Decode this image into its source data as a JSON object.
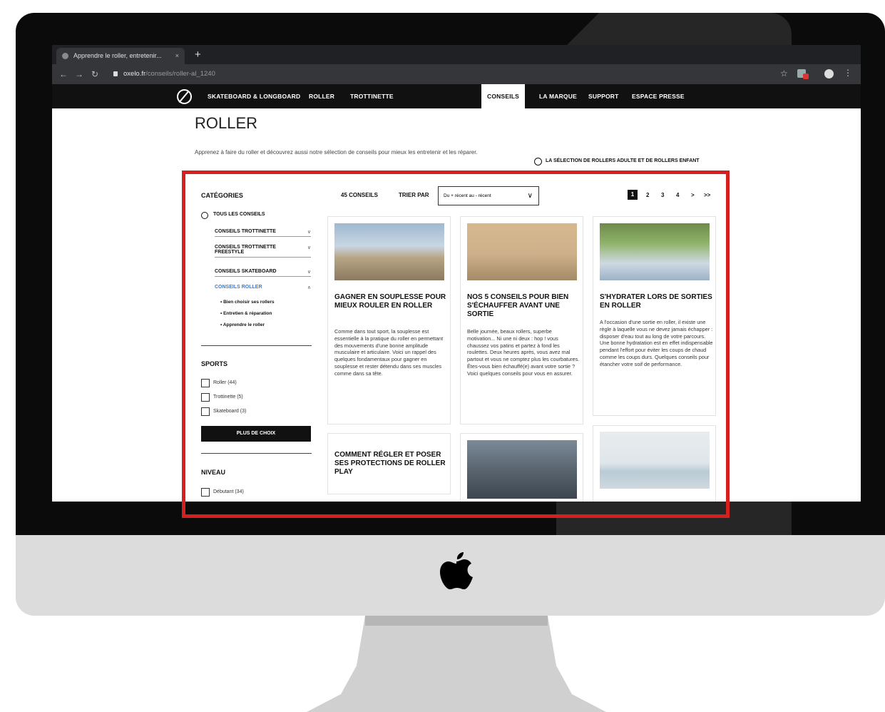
{
  "browser": {
    "tab_title": "Apprendre le roller, entretenir...",
    "tab_close": "×",
    "new_tab": "+",
    "url_host": "oxelo.fr",
    "url_path": "/conseils/roller-al_1240"
  },
  "site_nav": {
    "links": [
      "SKATEBOARD & LONGBOARD",
      "ROLLER",
      "TROTTINETTE",
      "CONSEILS",
      "LA MARQUE",
      "SUPPORT",
      "ESPACE PRESSE"
    ],
    "active": "CONSEILS"
  },
  "page": {
    "title": "ROLLER",
    "intro": "Apprenez à faire du roller et découvrez aussi notre sélection de conseils pour mieux les entretenir et les réparer.",
    "cta": "LA SÉLECTION DE ROLLERS ADULTE ET DE ROLLERS ENFANT"
  },
  "sidebar": {
    "categories_title": "CATÉGORIES",
    "all_link": "TOUS LES CONSEILS",
    "categories": [
      {
        "label": "CONSEILS TROTTINETTE",
        "chevron": "∨"
      },
      {
        "label": "CONSEILS TROTTINETTE FREESTYLE",
        "chevron": "∨"
      },
      {
        "label": "CONSEILS SKATEBOARD",
        "chevron": "∨"
      },
      {
        "label": "CONSEILS ROLLER",
        "chevron": "∧"
      }
    ],
    "roller_subitems": [
      "• Bien choisir ses rollers",
      "• Entretien & réparation",
      "• Apprendre le roller"
    ],
    "sports_title": "SPORTS",
    "sports": [
      "Roller (44)",
      "Trottinette (5)",
      "Skateboard (3)"
    ],
    "more_button": "PLUS DE CHOIX",
    "level_title": "NIVEAU",
    "levels": [
      "Débutant (34)"
    ]
  },
  "listing": {
    "count": "45 CONSEILS",
    "sort_label": "TRIER PAR",
    "sort_value": "Du + récent au - récent",
    "pagination": [
      "1",
      "2",
      "3",
      "4",
      ">",
      ">>"
    ],
    "current_page": "1"
  },
  "cards": [
    {
      "title": "GAGNER EN SOUPLESSE POUR MIEUX ROULER EN ROLLER",
      "body": "Comme dans tout sport, la souplesse est essentielle à la pratique du roller en permettant des mouvements d'une bonne amplitude musculaire et articulaire. Voici un rappel des quelques fondamentaux pour gagner en souplesse et rester détendu dans ses muscles comme dans sa tête."
    },
    {
      "title": "NOS 5 CONSEILS POUR BIEN S'ÉCHAUFFER AVANT UNE SORTIE",
      "body": "Belle journée, beaux rollers, superbe motivation... Ni une ni deux : hop ! vous chaussez vos patins et partez à fond les roulettes. Deux heures après, vous avez mal partout et vous ne comptez plus les courbatures. Êtes-vous bien échauffé(e) avant votre sortie ? Voici quelques conseils pour vous en assurer."
    },
    {
      "title": "S'HYDRATER LORS DE SORTIES EN ROLLER",
      "body": "A l'occasion d'une sortie en roller, il existe une règle à laquelle vous ne devez jamais échapper : disposer d'eau tout au long de votre parcours. Une bonne hydratation est en effet indispensable pendant l'effort pour éviter les coups de chaud comme les coups durs. Quelques conseils pour étancher votre soif de performance."
    },
    {
      "title": "COMMENT RÉGLER ET POSER SES PROTECTIONS DE ROLLER PLAY",
      "body": ""
    }
  ],
  "colors": {
    "highlight": "#d6201f",
    "nav_bg": "#111111",
    "active_sub": "#3a7bd5"
  }
}
